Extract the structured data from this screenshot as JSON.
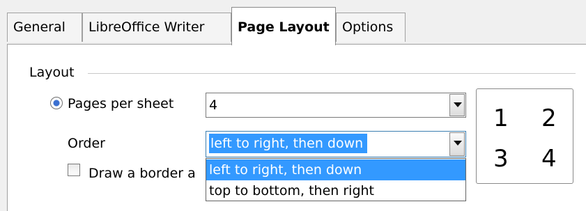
{
  "tabs": [
    {
      "label": "General"
    },
    {
      "label": "LibreOffice Writer"
    },
    {
      "label": "Page Layout"
    },
    {
      "label": "Options"
    }
  ],
  "active_tab": "Page Layout",
  "layout": {
    "group_label": "Layout",
    "pages_per_sheet_label": "Pages per sheet",
    "pages_per_sheet_value": "4",
    "order_label": "Order",
    "order_value": "left to right, then down",
    "order_options": [
      "left to right, then down",
      "top to bottom, then right"
    ],
    "border_label": "Draw a border a",
    "preview_numbers": [
      "1",
      "2",
      "3",
      "4"
    ]
  },
  "colors": {
    "selection": "#3399ff",
    "panel": "#ffffff",
    "background": "#f0f0f0"
  }
}
